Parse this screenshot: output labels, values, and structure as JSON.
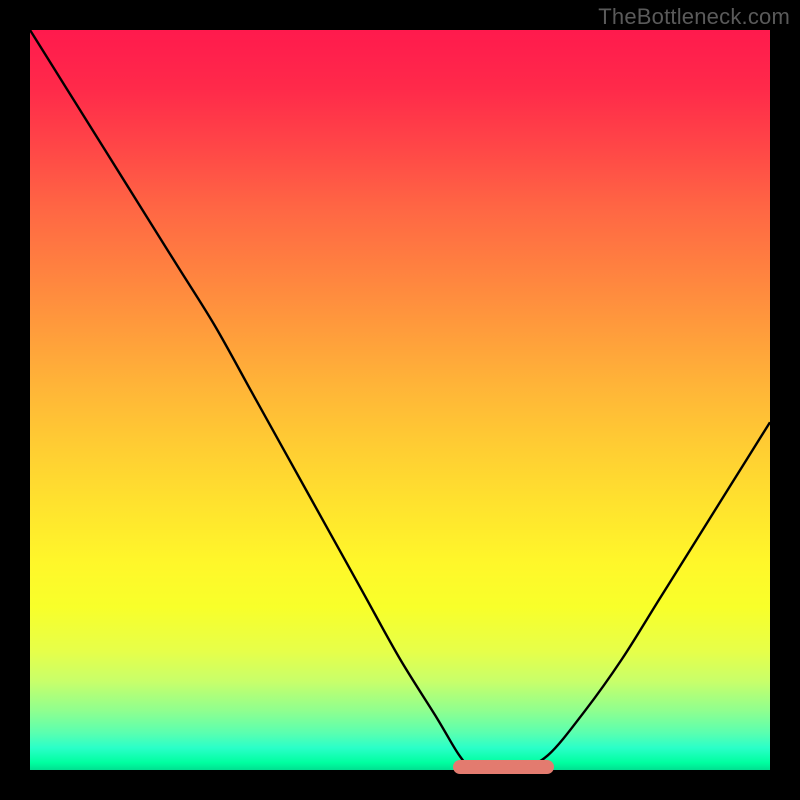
{
  "watermark": "TheBottleneck.com",
  "colors": {
    "frame": "#000000",
    "curve": "#000000",
    "flat_marker": "#e37b6f",
    "watermark": "#5a5a5a"
  },
  "chart_data": {
    "type": "line",
    "title": "",
    "xlabel": "",
    "ylabel": "",
    "xlim": [
      0,
      100
    ],
    "ylim": [
      0,
      100
    ],
    "grid": false,
    "legend": false,
    "background": "vertical-gradient red→yellow→green (bottleneck heatmap)",
    "series": [
      {
        "name": "bottleneck-curve",
        "x": [
          0,
          5,
          10,
          15,
          20,
          25,
          30,
          35,
          40,
          45,
          50,
          55,
          58,
          60,
          63,
          66,
          70,
          75,
          80,
          85,
          90,
          95,
          100
        ],
        "values": [
          100,
          92,
          84,
          76,
          68,
          60,
          51,
          42,
          33,
          24,
          15,
          7,
          2,
          0,
          0,
          0,
          2,
          8,
          15,
          23,
          31,
          39,
          47
        ]
      }
    ],
    "annotations": [
      {
        "name": "optimal-flat-region",
        "x_start": 58,
        "x_end": 70,
        "y": 0
      }
    ],
    "description": "V-shaped bottleneck curve. Left branch descends steeply from 100 at x=0 to 0 near x≈60; short flat minimum roughly over x≈58–70 marked by a salmon rounded bar; right branch rises with moderate slope to about 47 at x=100."
  }
}
